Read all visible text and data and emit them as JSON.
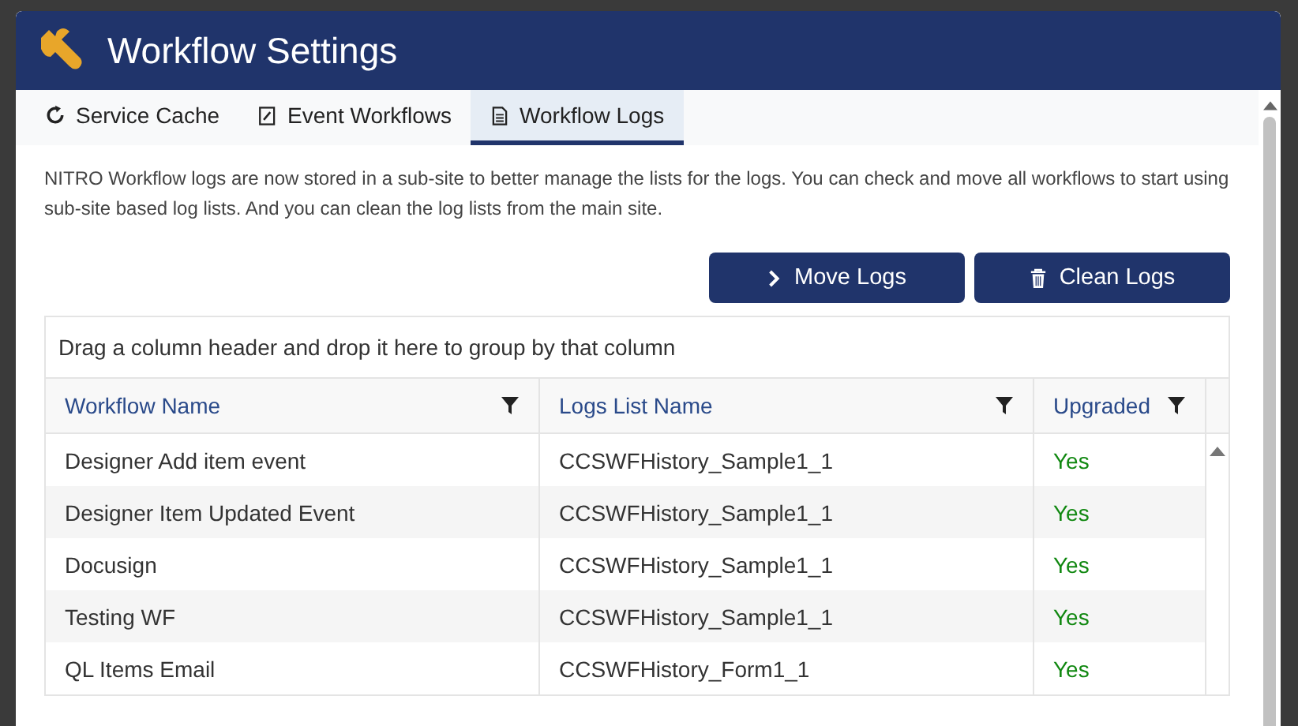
{
  "window": {
    "title": "Workflow Settings"
  },
  "tabs": [
    {
      "label": "Service Cache",
      "selected": false
    },
    {
      "label": "Event Workflows",
      "selected": false
    },
    {
      "label": "Workflow Logs",
      "selected": true
    }
  ],
  "description": "NITRO Workflow logs are now stored in a sub-site to better manage the lists for the logs. You can check and move all workflows to start using sub-site based log lists. And you can clean the log lists from the main site.",
  "buttons": [
    {
      "label": "Move Logs"
    },
    {
      "label": "Clean Logs"
    }
  ],
  "table": {
    "group_hint": "Drag a column header and drop it here to group by that column",
    "columns": [
      "Workflow Name",
      "Logs List Name",
      "Upgraded"
    ],
    "rows": [
      [
        "Designer Add item event",
        "CCSWFHistory_Sample1_1",
        "Yes"
      ],
      [
        "Designer Item Updated Event",
        "CCSWFHistory_Sample1_1",
        "Yes"
      ],
      [
        "Docusign",
        "CCSWFHistory_Sample1_1",
        "Yes"
      ],
      [
        "Testing WF",
        "CCSWFHistory_Sample1_1",
        "Yes"
      ],
      [
        "QL Items Email",
        "CCSWFHistory_Form1_1",
        "Yes"
      ]
    ]
  }
}
